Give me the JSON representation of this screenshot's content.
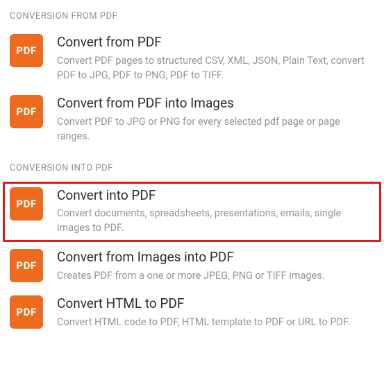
{
  "icon_label": "PDF",
  "sections": {
    "from_pdf": {
      "header": "CONVERSION FROM PDF",
      "items": {
        "convert_from_pdf": {
          "title": "Convert from PDF",
          "desc": "Convert PDF pages to structured CSV, XML, JSON, Plain Text, convert PDF to JPG, PDF to PNG, PDF to TIFF."
        },
        "convert_from_pdf_images": {
          "title": "Convert from PDF into Images",
          "desc": "Convert PDF to JPG or PNG for every selected pdf page or page ranges."
        }
      }
    },
    "into_pdf": {
      "header": "CONVERSION INTO PDF",
      "items": {
        "convert_into_pdf": {
          "title": "Convert into PDF",
          "desc": "Convert documents, spreadsheets, presentations, emails, single images to PDF."
        },
        "convert_images_into_pdf": {
          "title": "Convert from Images into PDF",
          "desc": "Creates PDF from a one or more JPEG, PNG or TIFF images."
        },
        "convert_html_to_pdf": {
          "title": "Convert HTML to PDF",
          "desc": "Convert HTML code to PDF, HTML template to PDF or URL to PDF."
        }
      }
    }
  }
}
